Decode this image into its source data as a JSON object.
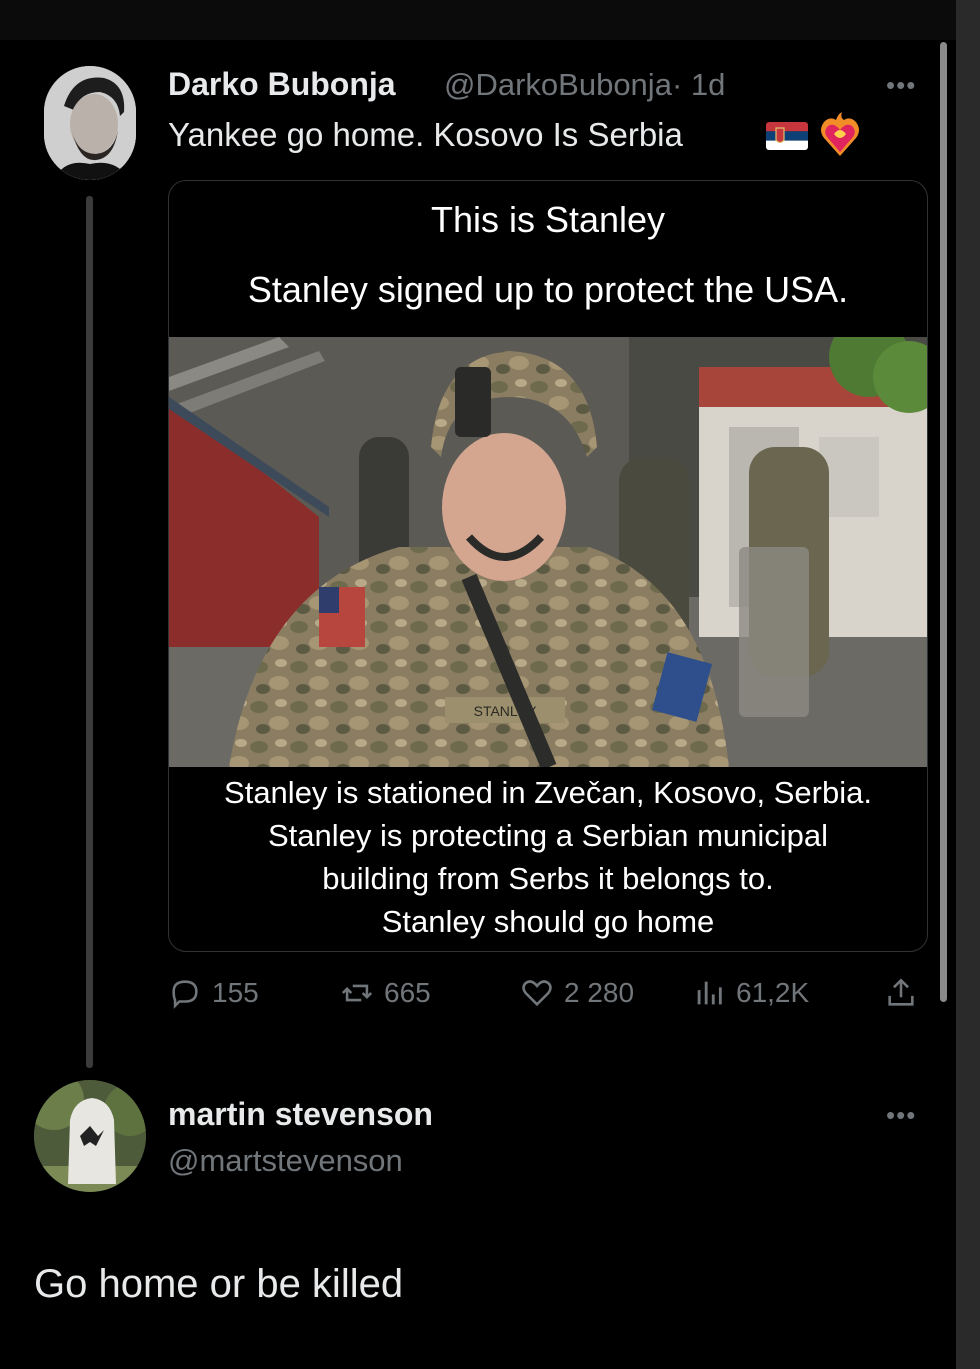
{
  "post": {
    "author_name": "Darko Bubonja",
    "author_handle": "@DarkoBubonja",
    "time": "· 1d",
    "text": "Yankee go home. Kosovo Is Serbia",
    "emojis": [
      "serbia-flag-icon",
      "heart-on-fire-icon"
    ],
    "card": {
      "header_line1": "This is Stanley",
      "header_line2": "Stanley signed up to protect the USA.",
      "name_tape": "STANLEY",
      "caption_lines": [
        "Stanley is stationed in Zvečan, Kosovo, Serbia.",
        "Stanley is protecting a Serbian municipal",
        "building from Serbs it belongs to.",
        "Stanley should go home"
      ]
    },
    "stats": {
      "replies": "155",
      "reposts": "665",
      "likes": "2 280",
      "views": "61,2K"
    }
  },
  "reply": {
    "author_name": "martin stevenson",
    "author_handle": "@martstevenson",
    "text": "Go home or be killed"
  },
  "colors": {
    "background": "#000000",
    "text": "#e7e9ea",
    "muted": "#71767b",
    "border": "#2f3336"
  }
}
